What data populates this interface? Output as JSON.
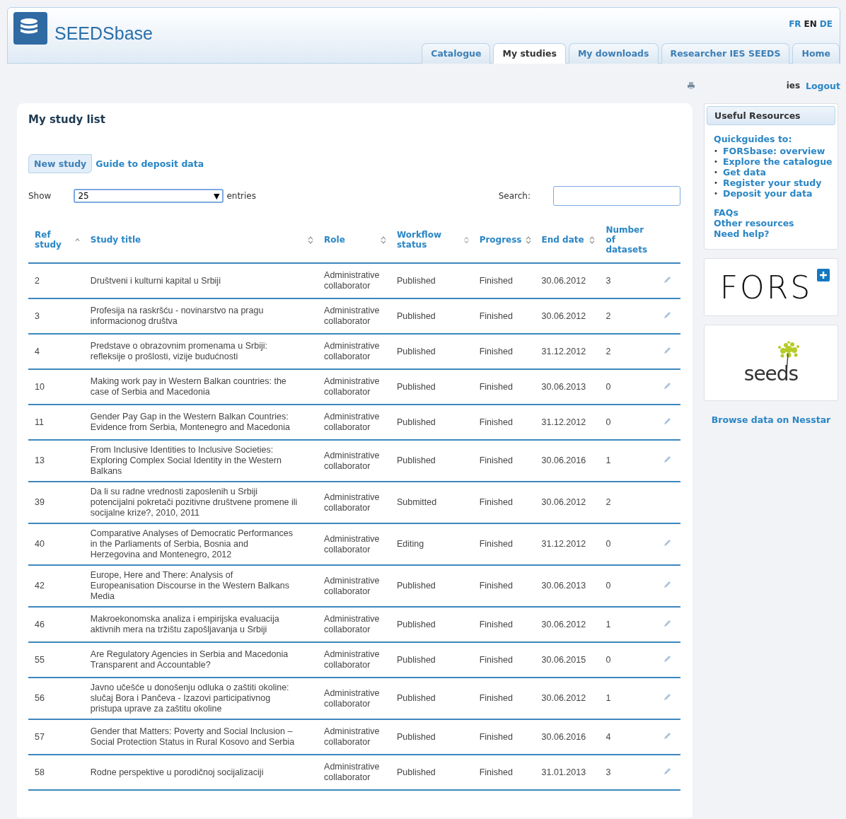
{
  "header": {
    "logo_text": "SEEDSbase",
    "languages": [
      {
        "label": "FR",
        "selected": false
      },
      {
        "label": "EN",
        "selected": true
      },
      {
        "label": "DE",
        "selected": false
      }
    ],
    "tabs": [
      {
        "label": "Catalogue",
        "selected": false
      },
      {
        "label": "My studies",
        "selected": true
      },
      {
        "label": "My downloads",
        "selected": false
      },
      {
        "label": "Researcher IES SEEDS",
        "selected": false
      },
      {
        "label": "Home",
        "selected": false
      }
    ]
  },
  "user": {
    "name": "ies",
    "logout": "Logout"
  },
  "main": {
    "title": "My study list",
    "buttons": [
      {
        "label": "New study",
        "kind": "button"
      },
      {
        "label": "Guide to deposit data",
        "kind": "link"
      }
    ],
    "show": {
      "label": "Show",
      "value": "25",
      "caret": "▼",
      "suffix": "entries"
    },
    "search": {
      "label": "Search:"
    },
    "table": {
      "columns": [
        {
          "label": "Ref study",
          "sortable": true,
          "sorted_ascending": true
        },
        {
          "label": "Study title",
          "sortable": true,
          "sorted_ascending": false
        },
        {
          "label": "Role",
          "sortable": true,
          "sorted_ascending": false
        },
        {
          "label": "Workflow status",
          "sortable": true,
          "sorted_ascending": false
        },
        {
          "label": "Progress",
          "sortable": true,
          "sorted_ascending": false
        },
        {
          "label": "End date",
          "sortable": true,
          "sorted_ascending": false
        },
        {
          "label": "Number of datasets",
          "sortable": false
        }
      ],
      "rows": [
        {
          "ref": "2",
          "title": "Društveni i kulturni kapital u Srbiji",
          "role": "Administrative collaborator",
          "workflow": "Published",
          "progress": "Finished",
          "end_date": "30.06.2012",
          "datasets": "3",
          "editable": true
        },
        {
          "ref": "3",
          "title": "Profesija na raskršću - novinarstvo na pragu informacionog društva",
          "role": "Administrative collaborator",
          "workflow": "Published",
          "progress": "Finished",
          "end_date": "30.06.2012",
          "datasets": "2",
          "editable": true
        },
        {
          "ref": "4",
          "title": "Predstave o obrazovnim promenama u Srbiji: refleksije o prošlosti, vizije budućnosti",
          "role": "Administrative collaborator",
          "workflow": "Published",
          "progress": "Finished",
          "end_date": "31.12.2012",
          "datasets": "2",
          "editable": true
        },
        {
          "ref": "10",
          "title": "Making work pay in Western Balkan countries: the case of Serbia and Macedonia",
          "role": "Administrative collaborator",
          "workflow": "Published",
          "progress": "Finished",
          "end_date": "30.06.2013",
          "datasets": "0",
          "editable": true
        },
        {
          "ref": "11",
          "title": "Gender Pay Gap in the Western Balkan Countries: Evidence from Serbia, Montenegro and Macedonia",
          "role": "Administrative collaborator",
          "workflow": "Published",
          "progress": "Finished",
          "end_date": "31.12.2012",
          "datasets": "0",
          "editable": true
        },
        {
          "ref": "13",
          "title": "From Inclusive Identities to Inclusive Societies: Exploring Complex Social Identity in the Western Balkans",
          "role": "Administrative collaborator",
          "workflow": "Published",
          "progress": "Finished",
          "end_date": "30.06.2016",
          "datasets": "1",
          "editable": true
        },
        {
          "ref": "39",
          "title": "Da li su radne vrednosti zaposlenih u Srbiji potencijalni pokretači pozitivne društvene promene ili socijalne krize?, 2010, 2011",
          "role": "Administrative collaborator",
          "workflow": "Submitted",
          "progress": "Finished",
          "end_date": "30.06.2012",
          "datasets": "2",
          "editable": false
        },
        {
          "ref": "40",
          "title": "Comparative Analyses of Democratic Performances in the Parliaments of Serbia, Bosnia and Herzegovina and Montenegro, 2012",
          "role": "Administrative collaborator",
          "workflow": "Editing",
          "progress": "Finished",
          "end_date": "31.12.2012",
          "datasets": "0",
          "editable": true
        },
        {
          "ref": "42",
          "title": "Europe, Here and There: Analysis of Europeanisation Discourse in the Western Balkans Media",
          "role": "Administrative collaborator",
          "workflow": "Published",
          "progress": "Finished",
          "end_date": "30.06.2013",
          "datasets": "0",
          "editable": true
        },
        {
          "ref": "46",
          "title": "Makroekonomska analiza i empirijska evaluacija aktivnih mera na tržištu zapošljavanja u Srbiji",
          "role": "Administrative collaborator",
          "workflow": "Published",
          "progress": "Finished",
          "end_date": "30.06.2012",
          "datasets": "1",
          "editable": true
        },
        {
          "ref": "55",
          "title": "Are Regulatory Agencies in Serbia and Macedonia Transparent and Accountable?",
          "role": "Administrative collaborator",
          "workflow": "Published",
          "progress": "Finished",
          "end_date": "30.06.2015",
          "datasets": "0",
          "editable": true
        },
        {
          "ref": "56",
          "title": "Javno učešće u donošenju odluka o zaštiti okoline: slučaj Bora i Pančeva - Izazovi participativnog pristupa uprave za zaštitu okoline",
          "role": "Administrative collaborator",
          "workflow": "Published",
          "progress": "Finished",
          "end_date": "30.06.2012",
          "datasets": "1",
          "editable": true
        },
        {
          "ref": "57",
          "title": "Gender that Matters: Poverty and Social Inclusion – Social Protection Status in Rural Kosovo and Serbia",
          "role": "Administrative collaborator",
          "workflow": "Published",
          "progress": "Finished",
          "end_date": "30.06.2016",
          "datasets": "4",
          "editable": true
        },
        {
          "ref": "58",
          "title": "Rodne perspektive u porodičnoj socijalizaciji",
          "role": "Administrative collaborator",
          "workflow": "Published",
          "progress": "Finished",
          "end_date": "31.01.2013",
          "datasets": "3",
          "editable": true
        }
      ]
    }
  },
  "sidebar": {
    "resources": {
      "title": "Useful Resources",
      "intro": "Quickguides to:",
      "bullet": "•",
      "guides": [
        "FORSbase: overview",
        "Explore the catalogue",
        "Get data",
        "Register your study",
        "Deposit your data"
      ],
      "links": [
        "FAQs",
        "Other resources",
        "Need help?"
      ]
    },
    "fors_logo": "FORS",
    "seeds_logo": "seeds",
    "nesstar_link": "Browse data on Nesstar"
  }
}
